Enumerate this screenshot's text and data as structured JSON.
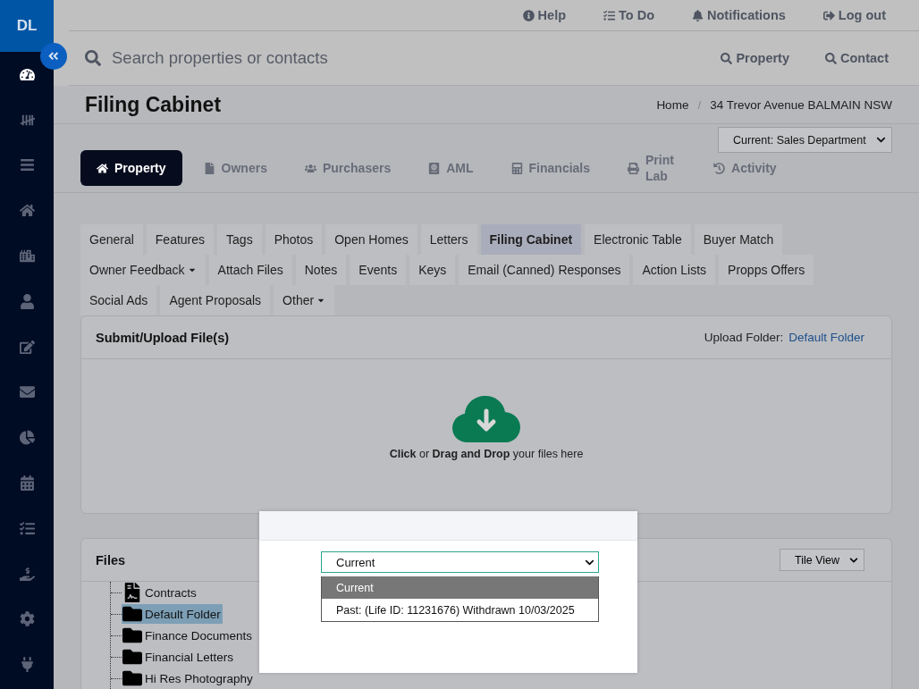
{
  "sidebar": {
    "initials": "DL",
    "items": [
      {
        "selected": true
      },
      {
        "selected": false
      },
      {
        "selected": false
      },
      {
        "selected": false
      },
      {
        "selected": false
      },
      {
        "selected": false
      },
      {
        "selected": false
      },
      {
        "selected": false
      },
      {
        "selected": false
      },
      {
        "selected": false
      },
      {
        "selected": false
      },
      {
        "selected": false
      },
      {
        "selected": false
      },
      {
        "selected": false
      }
    ]
  },
  "top_links": [
    {
      "label": "Help"
    },
    {
      "label": "To Do"
    },
    {
      "label": "Notifications"
    },
    {
      "label": "Log out"
    }
  ],
  "search": {
    "placeholder": "Search properties or contacts",
    "buttons": [
      "Property",
      "Contact"
    ]
  },
  "page_title": "Filing Cabinet",
  "breadcrumb": {
    "separator": "/",
    "items": [
      "Home",
      "34 Trevor Avenue BALMAIN NSW"
    ]
  },
  "module_tabs": [
    {
      "label": "Property",
      "selected": true
    },
    {
      "label": "Owners",
      "selected": false
    },
    {
      "label": "Purchasers",
      "selected": false
    },
    {
      "label": "AML",
      "selected": false
    },
    {
      "label": "Financials",
      "selected": false
    },
    {
      "label": "Print Lab",
      "selected": false
    },
    {
      "label": "Activity",
      "selected": false
    }
  ],
  "department_select": {
    "value": "Current: Sales Department"
  },
  "sub_tabs": [
    {
      "label": "General",
      "selected": false,
      "kind": "tab"
    },
    {
      "label": "Features",
      "selected": false,
      "kind": "tab"
    },
    {
      "label": "Tags",
      "selected": false,
      "kind": "tab"
    },
    {
      "label": "Photos",
      "selected": false,
      "kind": "tab"
    },
    {
      "label": "Open Homes",
      "selected": false,
      "kind": "tab"
    },
    {
      "label": "Letters",
      "selected": false,
      "kind": "tab"
    },
    {
      "label": "Filing Cabinet",
      "selected": true,
      "kind": "tab"
    },
    {
      "label": "Electronic Table",
      "selected": false,
      "kind": "tab"
    },
    {
      "label": "Buyer Match",
      "selected": false,
      "kind": "tab"
    },
    {
      "label": "Owner Feedback",
      "selected": false,
      "kind": "dropdown"
    },
    {
      "label": "Attach Files",
      "selected": false,
      "kind": "tab"
    },
    {
      "label": "Notes",
      "selected": false,
      "kind": "tab"
    },
    {
      "label": "Events",
      "selected": false,
      "kind": "tab"
    },
    {
      "label": "Keys",
      "selected": false,
      "kind": "tab"
    },
    {
      "label": "Email (Canned) Responses",
      "selected": false,
      "kind": "tab"
    },
    {
      "label": "Action Lists",
      "selected": false,
      "kind": "tab"
    },
    {
      "label": "Propps Offers",
      "selected": false,
      "kind": "tab"
    },
    {
      "label": "Social Ads",
      "selected": false,
      "kind": "tab"
    },
    {
      "label": "Agent Proposals",
      "selected": false,
      "kind": "tab"
    },
    {
      "label": "Other",
      "selected": false,
      "kind": "dropdown"
    }
  ],
  "upload_panel": {
    "title": "Submit/Upload File(s)",
    "folder_label": "Upload Folder:",
    "folder_link": "Default Folder",
    "drop_text": "**Click** or **Drag and Drop** your files here"
  },
  "files_panel": {
    "title": "Files",
    "view_select": "Tile View",
    "tree": [
      {
        "label": "Contracts",
        "kind": "document",
        "selected": false
      },
      {
        "label": "Default Folder",
        "kind": "folder",
        "selected": true
      },
      {
        "label": "Finance Documents",
        "kind": "folder",
        "selected": false
      },
      {
        "label": "Financial Letters",
        "kind": "folder",
        "selected": false
      },
      {
        "label": "Hi Res Photography",
        "kind": "folder",
        "selected": false
      }
    ]
  },
  "modal": {
    "select_value": "Current",
    "options": [
      {
        "label": "Current",
        "selected": true
      },
      {
        "label": "Past: (Life ID: 11231676) Withdrawn 10/03/2025",
        "selected": false
      }
    ]
  }
}
